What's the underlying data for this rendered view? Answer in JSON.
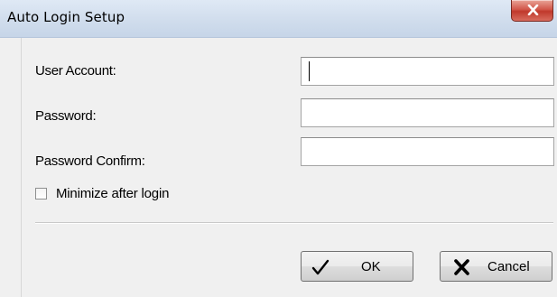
{
  "window": {
    "title": "Auto Login Setup"
  },
  "form": {
    "user_account": {
      "label": "User Account:",
      "value": ""
    },
    "password": {
      "label": "Password:",
      "value": ""
    },
    "password_confirm": {
      "label": "Password Confirm:",
      "value": ""
    },
    "minimize_after_login": {
      "label": "Minimize after login",
      "checked": false
    }
  },
  "buttons": {
    "ok_label": "OK",
    "cancel_label": "Cancel"
  },
  "icons": {
    "close": "close-icon",
    "ok": "checkmark-icon",
    "cancel": "x-icon"
  }
}
